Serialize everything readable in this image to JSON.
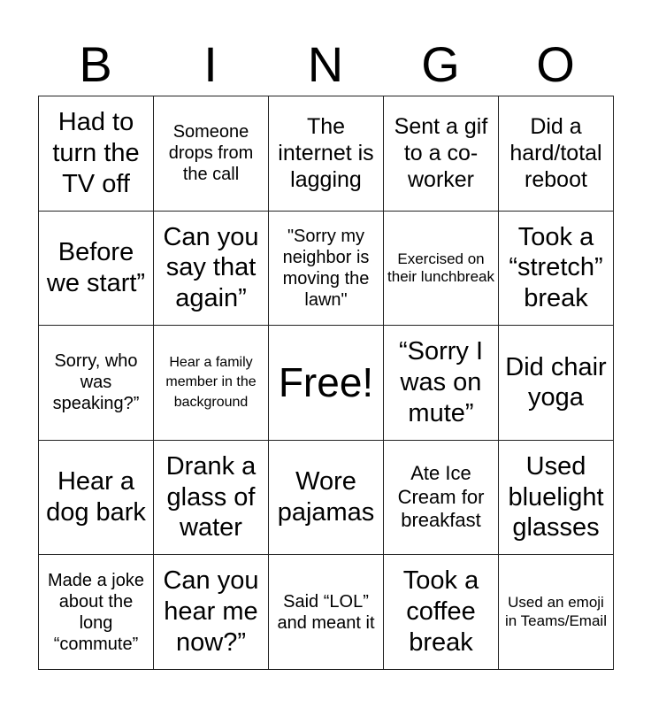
{
  "header": {
    "letters": [
      "B",
      "I",
      "N",
      "G",
      "O"
    ]
  },
  "board": {
    "rows": [
      [
        "Had to turn the TV off",
        "Someone drops from the call",
        "The internet is lagging",
        "Sent a gif to a co-worker",
        "Did a hard/total reboot"
      ],
      [
        "Before we start”",
        "Can you say that again”",
        "\"Sorry my neighbor is moving the lawn\"",
        "Exercised on their lunchbreak",
        "Took a “stretch” break"
      ],
      [
        "Sorry, who was speaking?”",
        "Hear a family member in the background",
        "Free!",
        "“Sorry I was on mute”",
        "Did chair yoga"
      ],
      [
        "Hear a dog bark",
        "Drank a glass of water",
        "Wore pajamas",
        "Ate Ice Cream for breakfast",
        "Used bluelight glasses"
      ],
      [
        "Made a joke about the long “commute”",
        "Can you hear me now?”",
        "Said “LOL” and meant it",
        "Took a coffee break",
        "Used an emoji in Teams/Email"
      ]
    ],
    "free_cell": {
      "row": 2,
      "col": 2,
      "label": "Free!"
    }
  }
}
